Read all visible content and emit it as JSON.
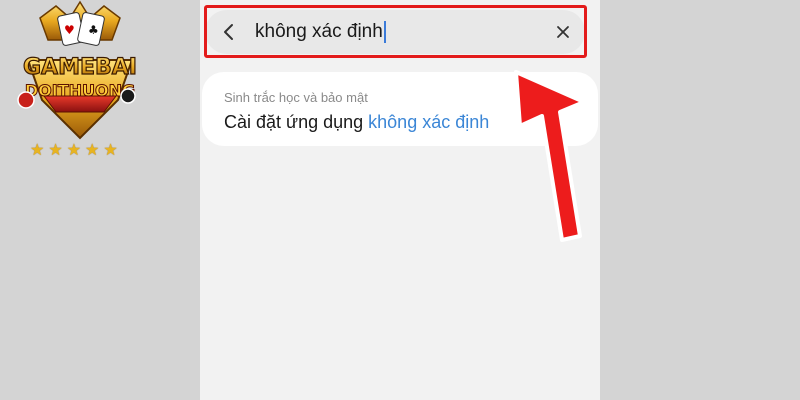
{
  "search": {
    "query": "không xác định",
    "back_icon": "chevron-left-icon",
    "clear_icon": "close-icon"
  },
  "result": {
    "category": "Sinh trắc học và bảo mật",
    "title_prefix": "Cài đặt ứng dụng ",
    "title_match": "không xác định"
  },
  "logo": {
    "line1": "GAMEBAI",
    "line2": "DOITHUONG",
    "stars": 5
  },
  "colors": {
    "highlight": "#e31b1b",
    "match_text": "#3b86d6",
    "background": "#d4d4d4",
    "phone_bg": "#f2f2f2"
  }
}
